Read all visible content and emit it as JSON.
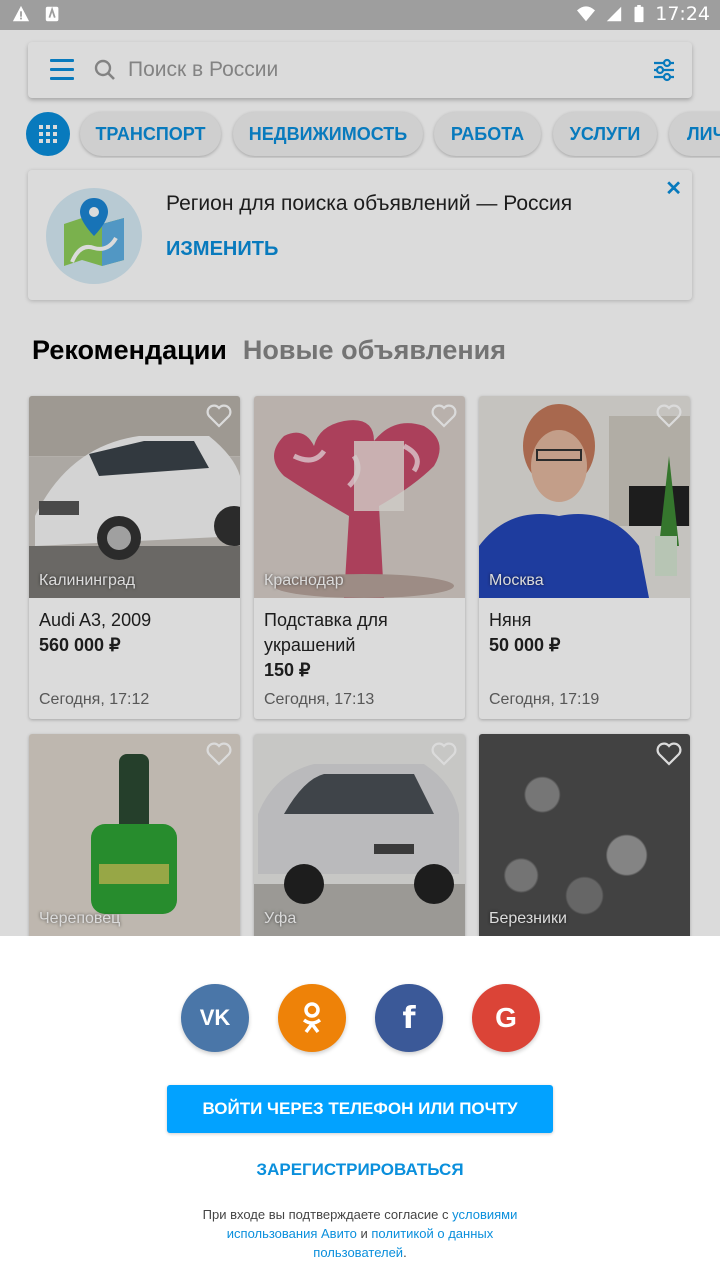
{
  "status_bar": {
    "time": "17:24"
  },
  "search": {
    "placeholder": "Поиск в России"
  },
  "categories": [
    "ТРАНСПОРТ",
    "НЕДВИЖИМОСТЬ",
    "РАБОТА",
    "УСЛУГИ",
    "ЛИЧНЫЕ ВЕЩИ"
  ],
  "region_banner": {
    "title": "Регион для поиска объявлений — Россия",
    "action": "ИЗМЕНИТЬ",
    "close": "✕"
  },
  "tabs": {
    "active": "Рекомендации",
    "inactive": "Новые объявления"
  },
  "listings": [
    {
      "city": "Калининград",
      "title": "Audi A3, 2009",
      "price": "560 000 ₽",
      "date": "Сегодня, 17:12"
    },
    {
      "city": "Краснодар",
      "title": "Подставка для украшений",
      "price": "150 ₽",
      "date": "Сегодня, 17:13"
    },
    {
      "city": "Москва",
      "title": "Няня",
      "price": "50 000 ₽",
      "date": "Сегодня, 17:19"
    },
    {
      "city": "Череповец"
    },
    {
      "city": "Уфа"
    },
    {
      "city": "Березники"
    }
  ],
  "login_sheet": {
    "social": [
      {
        "name": "vk",
        "label": "VK",
        "color": "#4a76a8"
      },
      {
        "name": "ok",
        "label": "ок",
        "color": "#ee8208"
      },
      {
        "name": "facebook",
        "label": "f",
        "color": "#3b5998"
      },
      {
        "name": "google",
        "label": "G",
        "color": "#db4437"
      }
    ],
    "login_button": "ВОЙТИ ЧЕРЕЗ ТЕЛЕФОН ИЛИ ПОЧТУ",
    "register": "ЗАРЕГИСТРИРОВАТЬСЯ",
    "legal_prefix": "При входе вы подтверждаете согласие с ",
    "legal_link_terms": "условиями использования Авито",
    "legal_and": " и ",
    "legal_link_privacy": "политикой о данных пользователей",
    "legal_suffix": "."
  },
  "colors": {
    "accent": "#0a8fdc",
    "primary_button": "#02a2ff"
  }
}
